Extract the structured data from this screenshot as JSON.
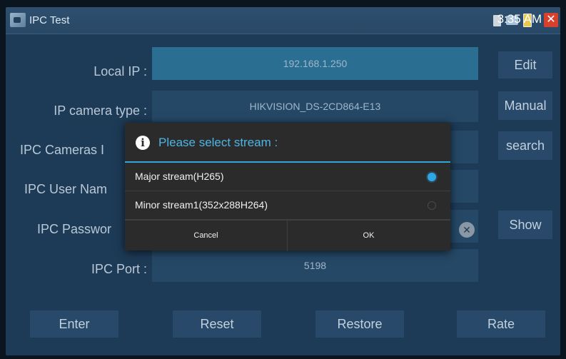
{
  "statusbar": {
    "title": "IPC Test",
    "time": "3:35 AM",
    "icons": [
      "app-icon",
      "sd-card-icon",
      "network-icon",
      "battery-icon",
      "close-icon"
    ],
    "close_glyph": "✕"
  },
  "form": {
    "local_ip": {
      "label": "Local IP :",
      "value": "192.168.1.250"
    },
    "camera_type": {
      "label": "IP camera type :",
      "value": "HIKVISION_DS-2CD864-E13"
    },
    "cameras": {
      "label": "IPC Cameras I",
      "value": ""
    },
    "user_name": {
      "label": "IPC User Nam",
      "value": ""
    },
    "password": {
      "label": "IPC Passwor",
      "value": ""
    },
    "port": {
      "label": "IPC Port :",
      "value": "5198"
    }
  },
  "side_buttons": {
    "edit": "Edit",
    "manual": "Manual",
    "search": "search",
    "show": "Show"
  },
  "bottom_buttons": {
    "enter": "Enter",
    "reset": "Reset",
    "restore": "Restore",
    "rate": "Rate"
  },
  "dialog": {
    "title": "Please select stream :",
    "options": [
      {
        "label": "Major stream(H265)",
        "selected": true
      },
      {
        "label": "Minor stream1(352x288H264)",
        "selected": false
      }
    ],
    "cancel": "Cancel",
    "ok": "OK"
  },
  "colors": {
    "background": "#1d3b57",
    "accent": "#2ea8e5",
    "dialog_bg": "#2b2b2b",
    "close_red": "#d8402e"
  }
}
